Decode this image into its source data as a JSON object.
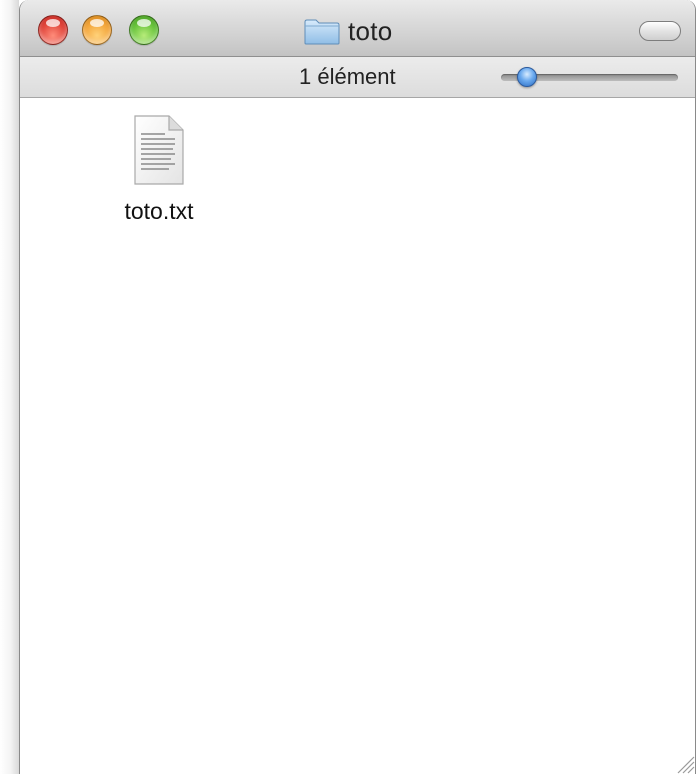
{
  "window": {
    "title": "toto",
    "title_icon": "folder-icon"
  },
  "statusbar": {
    "item_count": "1 élément",
    "zoom_level": 0.1
  },
  "files": [
    {
      "name": "toto.txt",
      "icon": "text-document-icon"
    }
  ],
  "colors": {
    "close": "#e0443a",
    "minimize": "#f3a53a",
    "maximize": "#66c23a",
    "slider_knob": "#4a8fe0"
  }
}
